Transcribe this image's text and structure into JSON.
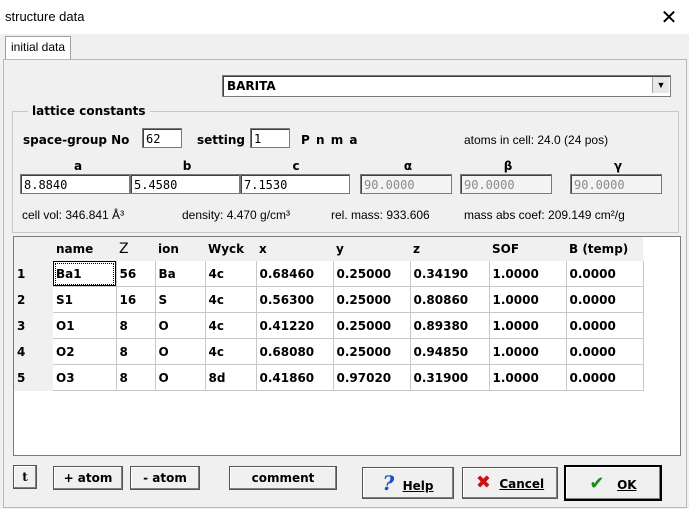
{
  "window": {
    "title": "structure data",
    "close_glyph": "✕"
  },
  "tab": {
    "label": "initial data"
  },
  "mineral": {
    "selected": "BARITA",
    "arrow": "▼"
  },
  "lattice": {
    "title": "lattice constants",
    "spacegroup_label": "space-group No",
    "spacegroup_value": "62",
    "setting_label": "setting",
    "setting_value": "1",
    "symbol": "P n m a",
    "atoms_in_cell": "atoms in cell: 24.0  (24 pos)",
    "col_a": "a",
    "col_b": "b",
    "col_c": "c",
    "col_alpha": "α",
    "col_beta": "β",
    "col_gamma": "γ",
    "a": "8.8840",
    "b": "5.4580",
    "c": "7.1530",
    "alpha": "90.0000",
    "beta": "90.0000",
    "gamma": "90.0000",
    "cell_vol": "cell vol: 346.841 Å³",
    "density": "density: 4.470 g/cm³",
    "rel_mass": "rel. mass: 933.606",
    "mass_abs": "mass abs coef: 209.149 cm²/g"
  },
  "atoms": {
    "headers": [
      "name",
      "Z",
      "ion",
      "Wyck",
      "x",
      "y",
      "z",
      "SOF",
      "B (temp)"
    ],
    "rows": [
      {
        "n": "1",
        "name": "Ba1",
        "Z": "56",
        "ion": "Ba",
        "wyck": "4c",
        "x": "0.68460",
        "y": "0.25000",
        "z": "0.34190",
        "sof": "1.0000",
        "b": "0.0000"
      },
      {
        "n": "2",
        "name": "S1",
        "Z": "16",
        "ion": "S",
        "wyck": "4c",
        "x": "0.56300",
        "y": "0.25000",
        "z": "0.80860",
        "sof": "1.0000",
        "b": "0.0000"
      },
      {
        "n": "3",
        "name": "O1",
        "Z": "8",
        "ion": "O",
        "wyck": "4c",
        "x": "0.41220",
        "y": "0.25000",
        "z": "0.89380",
        "sof": "1.0000",
        "b": "0.0000"
      },
      {
        "n": "4",
        "name": "O2",
        "Z": "8",
        "ion": "O",
        "wyck": "4c",
        "x": "0.68080",
        "y": "0.25000",
        "z": "0.94850",
        "sof": "1.0000",
        "b": "0.0000"
      },
      {
        "n": "5",
        "name": "O3",
        "Z": "8",
        "ion": "O",
        "wyck": "8d",
        "x": "0.41860",
        "y": "0.97020",
        "z": "0.31900",
        "sof": "1.0000",
        "b": "0.0000"
      }
    ]
  },
  "buttons": {
    "t_icon": "t",
    "add_atom": "+ atom",
    "remove_atom": "- atom",
    "comment": "comment",
    "help": "Help",
    "cancel": "Cancel",
    "ok": "OK"
  }
}
